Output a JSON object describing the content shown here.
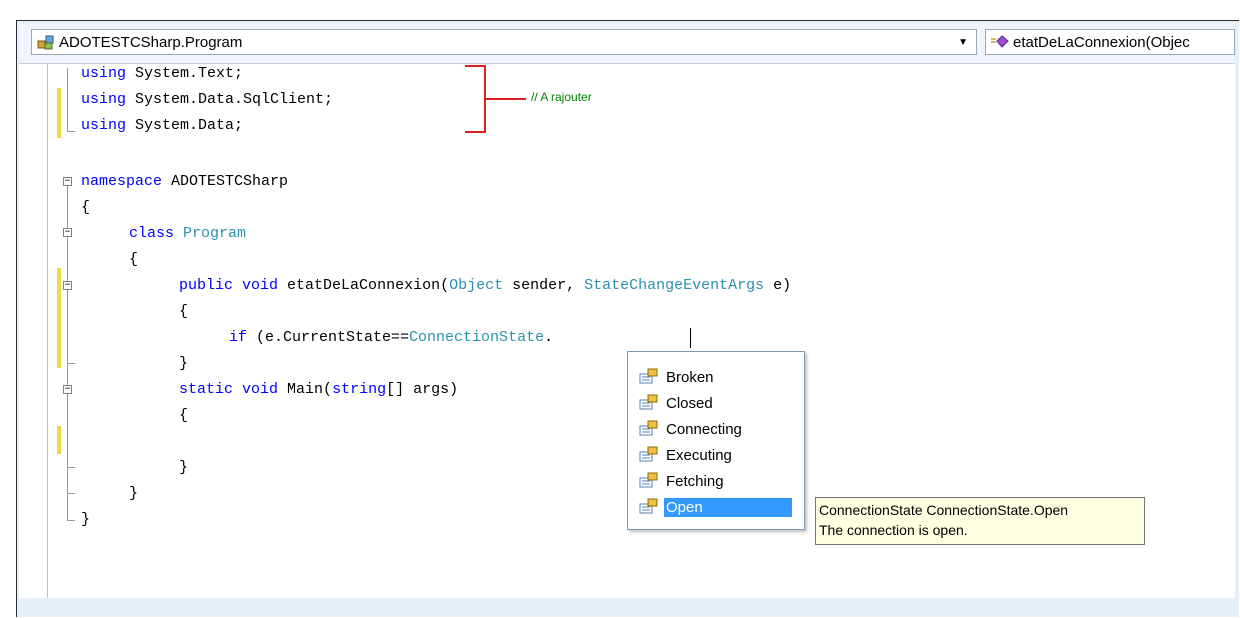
{
  "toolbar": {
    "class_selector": "ADOTESTCSharp.Program",
    "member_selector": "etatDeLaConnexion(Objec"
  },
  "code": {
    "line_using_text": {
      "kw": "using",
      "rest": " System.Text;"
    },
    "line_using_sql": {
      "kw": "using",
      "rest": " System.Data.SqlClient;"
    },
    "line_using_data": {
      "kw": "using",
      "rest": " System.Data;"
    },
    "comment": "// A rajouter",
    "line_namespace": {
      "kw": "namespace",
      "rest": " ADOTESTCSharp"
    },
    "brace_open": "{",
    "brace_close": "}",
    "line_class": {
      "kw": "class",
      "name": "Program"
    },
    "line_method": {
      "kw1": "public",
      "kw2": "void",
      "name": " etatDeLaConnexion(",
      "t1": "Object",
      "mid": " sender, ",
      "t2": "StateChangeEventArgs",
      "end": " e)"
    },
    "line_if": {
      "kw": "if",
      "mid": " (e.CurrentState==",
      "ty": "ConnectionState",
      "end": "."
    },
    "line_main": {
      "kw1": "static",
      "kw2": "void",
      "mid": " Main(",
      "kw3": "string",
      "end": "[] args)"
    }
  },
  "completion": {
    "items": [
      "Broken",
      "Closed",
      "Connecting",
      "Executing",
      "Fetching",
      "Open"
    ],
    "selected": "Open"
  },
  "tooltip": {
    "line1": "ConnectionState ConnectionState.Open",
    "line2": "The connection is open."
  },
  "colors": {
    "keyword": "#0000ff",
    "type": "#2b91af",
    "comment": "#008000",
    "annotation_bracket": "#e02020",
    "change_marker": "#f0d848",
    "selection": "#3399ff"
  },
  "icons": {
    "class_selector_icon": "class-icon",
    "member_selector_icon": "method-icon",
    "completion_item_icon": "enum-member-icon"
  }
}
